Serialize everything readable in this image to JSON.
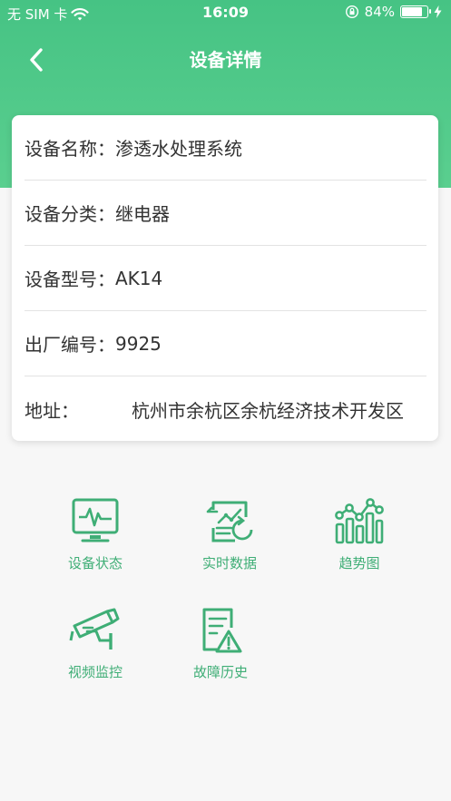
{
  "status_bar": {
    "carrier": "无 SIM 卡",
    "time": "16:09",
    "battery_percent": "84%",
    "battery_level": 0.84
  },
  "nav": {
    "title": "设备详情",
    "back_icon": "chevron-left-icon"
  },
  "details": [
    {
      "label": "设备名称：",
      "value": "渗透水处理系统"
    },
    {
      "label": "设备分类：",
      "value": "继电器"
    },
    {
      "label": "设备型号：",
      "value": "AK14"
    },
    {
      "label": "出厂编号：",
      "value": "9925"
    },
    {
      "label": "地址：",
      "value": "杭州市余杭区余杭经济技术开发区"
    }
  ],
  "functions": [
    {
      "label": "设备状态",
      "icon": "monitor-pulse-icon"
    },
    {
      "label": "实时数据",
      "icon": "realtime-data-icon"
    },
    {
      "label": "趋势图",
      "icon": "trend-chart-icon"
    },
    {
      "label": "视频监控",
      "icon": "cctv-camera-icon"
    },
    {
      "label": "故障历史",
      "icon": "fault-history-icon"
    }
  ],
  "colors": {
    "header_green": "#4fc98a",
    "icon_green": "#3fae76"
  }
}
